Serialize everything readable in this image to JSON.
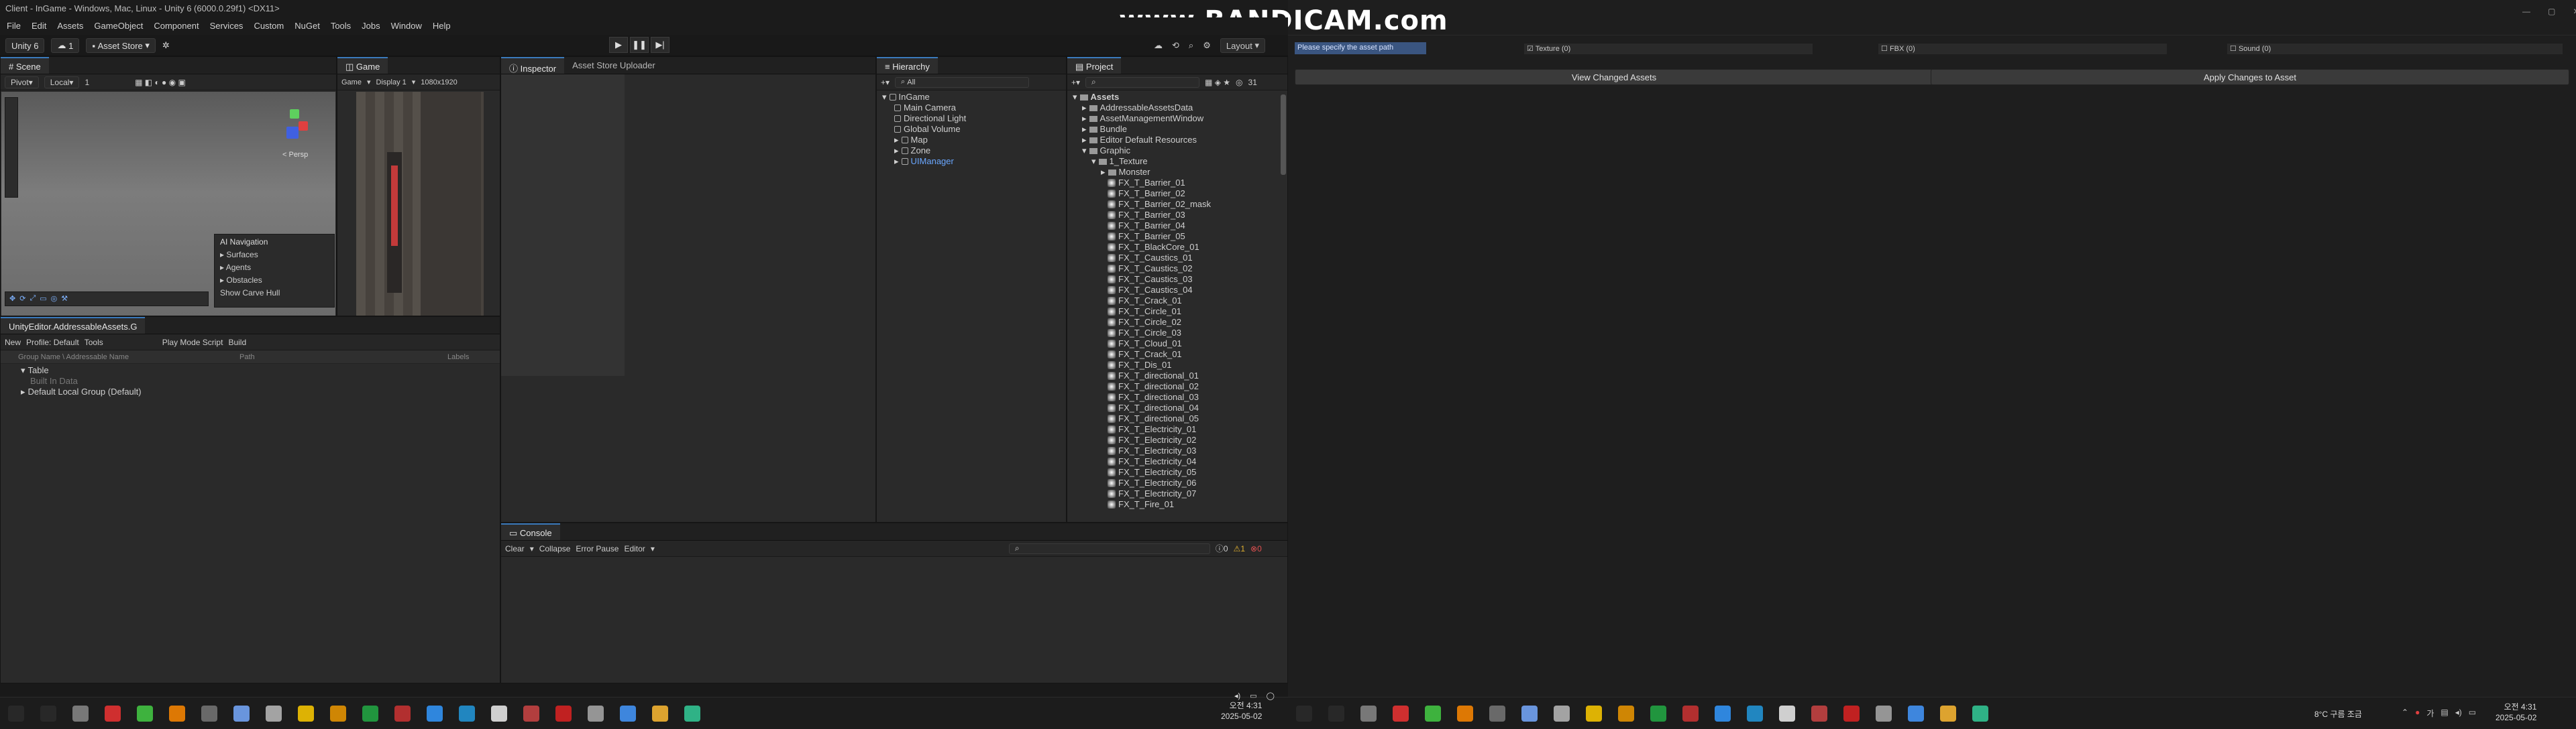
{
  "window": {
    "title": "Client - InGame - Windows, Mac, Linux - Unity 6 (6000.0.29f1) <DX11>"
  },
  "watermark": "www.BANDICAM.com",
  "menu": [
    "File",
    "Edit",
    "Assets",
    "GameObject",
    "Component",
    "Services",
    "Custom",
    "NuGet",
    "Tools",
    "Jobs",
    "Window",
    "Help"
  ],
  "toolbar": {
    "account": "Unity 6",
    "cloud": "1",
    "asset_store": "Asset Store",
    "layout": "Layout"
  },
  "scene": {
    "tab": "Scene",
    "pivot": "Pivot",
    "local": "Local",
    "num": "1",
    "persp": "< Persp",
    "nav_title": "AI Navigation",
    "nav_items": [
      "Surfaces",
      "Agents",
      "Obstacles",
      "Show Carve Hull"
    ]
  },
  "game": {
    "tab": "Game",
    "mode": "Game",
    "display": "Display 1",
    "res": "1080x1920"
  },
  "inspector": {
    "tab": "Inspector",
    "tab2": "Asset Store Uploader"
  },
  "hierarchy": {
    "tab": "Hierarchy",
    "search": "All",
    "items": [
      "InGame",
      "Main Camera",
      "Directional Light",
      "Global Volume",
      "Map",
      "Zone",
      "UIManager"
    ]
  },
  "project": {
    "tab": "Project",
    "count": "31",
    "folders": [
      "Assets",
      "AddressableAssetsData",
      "AssetManagementWindow",
      "Bundle",
      "Editor Default Resources",
      "Graphic",
      "1_Texture",
      "Monster"
    ],
    "files": [
      "FX_T_Barrier_01",
      "FX_T_Barrier_02",
      "FX_T_Barrier_02_mask",
      "FX_T_Barrier_03",
      "FX_T_Barrier_04",
      "FX_T_Barrier_05",
      "FX_T_BlackCore_01",
      "FX_T_Caustics_01",
      "FX_T_Caustics_02",
      "FX_T_Caustics_03",
      "FX_T_Caustics_04",
      "FX_T_Crack_01",
      "FX_T_Circle_01",
      "FX_T_Circle_02",
      "FX_T_Circle_03",
      "FX_T_Cloud_01",
      "FX_T_Crack_01",
      "FX_T_Dis_01",
      "FX_T_directional_01",
      "FX_T_directional_02",
      "FX_T_directional_03",
      "FX_T_directional_04",
      "FX_T_directional_05",
      "FX_T_Electricity_01",
      "FX_T_Electricity_02",
      "FX_T_Electricity_03",
      "FX_T_Electricity_04",
      "FX_T_Electricity_05",
      "FX_T_Electricity_06",
      "FX_T_Electricity_07",
      "FX_T_Fire_01"
    ]
  },
  "addressables": {
    "tab": "UnityEditor.AddressableAssets.G",
    "new": "New",
    "profile": "Profile: Default",
    "tools": "Tools",
    "playmode": "Play Mode Script",
    "build": "Build",
    "cols": [
      "Group Name \\ Addressable Name",
      "Path",
      "Labels"
    ],
    "rows": [
      "Table",
      "Built In Data",
      "Default Local Group (Default)"
    ]
  },
  "console": {
    "tab": "Console",
    "clear": "Clear",
    "collapse": "Collapse",
    "error_pause": "Error Pause",
    "editor": "Editor",
    "c_info": "0",
    "c_warn": "1",
    "c_err": "0"
  },
  "asset_tool": {
    "path_hint": "Please specify the asset path",
    "texture": "Texture (0)",
    "fbx": "FBX (0)",
    "sound": "Sound (0)",
    "view_btn": "View Changed Assets",
    "apply_btn": "Apply Changes to Asset"
  },
  "clock_left": {
    "time": "오전 4:31",
    "date": "2025-05-02"
  },
  "clock_right": {
    "weather": "8°C 구름 조금",
    "time": "오전 4:31",
    "date": "2025-05-02"
  }
}
